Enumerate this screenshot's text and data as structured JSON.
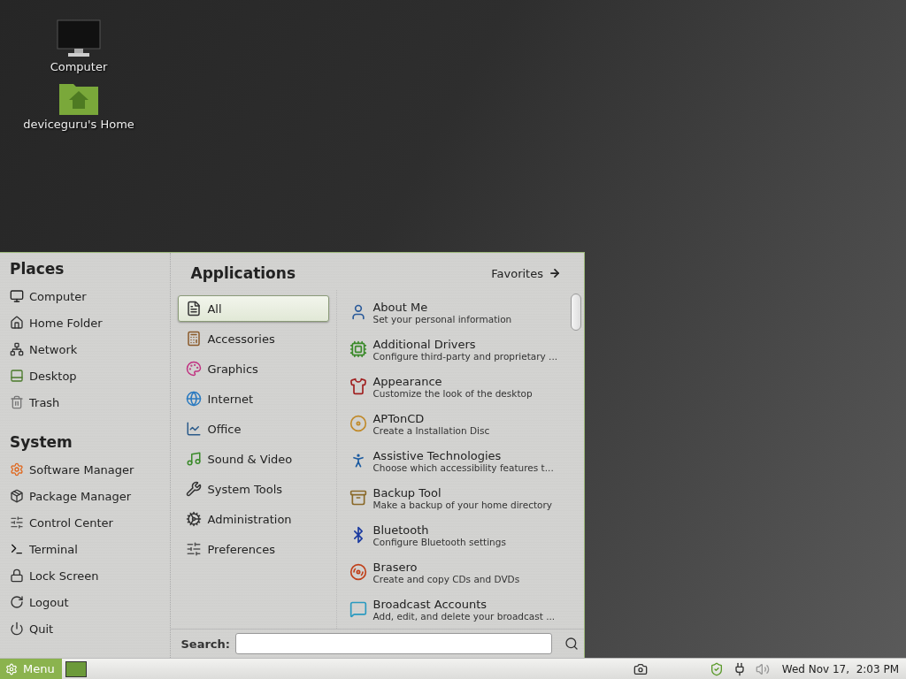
{
  "desktop_icons": [
    {
      "label": "Computer",
      "kind": "computer"
    },
    {
      "label": "deviceguru's Home",
      "kind": "home"
    }
  ],
  "menu": {
    "places": {
      "title": "Places",
      "items": [
        "Computer",
        "Home Folder",
        "Network",
        "Desktop",
        "Trash"
      ]
    },
    "system": {
      "title": "System",
      "items": [
        "Software Manager",
        "Package Manager",
        "Control Center",
        "Terminal",
        "Lock Screen",
        "Logout",
        "Quit"
      ]
    },
    "applications_title": "Applications",
    "favorites_button": "Favorites",
    "categories": [
      {
        "label": "All",
        "selected": true
      },
      {
        "label": "Accessories",
        "selected": false
      },
      {
        "label": "Graphics",
        "selected": false
      },
      {
        "label": "Internet",
        "selected": false
      },
      {
        "label": "Office",
        "selected": false
      },
      {
        "label": "Sound & Video",
        "selected": false
      },
      {
        "label": "System Tools",
        "selected": false
      },
      {
        "label": "Administration",
        "selected": false
      },
      {
        "label": "Preferences",
        "selected": false
      }
    ],
    "apps": [
      {
        "name": "About Me",
        "description": "Set your personal information"
      },
      {
        "name": "Additional Drivers",
        "description": "Configure third-party and proprietary ..."
      },
      {
        "name": "Appearance",
        "description": "Customize the look of the desktop"
      },
      {
        "name": "APTonCD",
        "description": "Create a Installation Disc"
      },
      {
        "name": "Assistive Technologies",
        "description": "Choose which accessibility features t..."
      },
      {
        "name": "Backup Tool",
        "description": "Make a backup of your home directory"
      },
      {
        "name": "Bluetooth",
        "description": "Configure Bluetooth settings"
      },
      {
        "name": "Brasero",
        "description": "Create and copy CDs and DVDs"
      },
      {
        "name": "Broadcast Accounts",
        "description": "Add, edit, and delete your broadcast ..."
      }
    ],
    "search": {
      "label": "Search:"
    }
  },
  "taskbar": {
    "menu_button": "Menu",
    "clock": "Wed Nov 17,  2:03 PM"
  }
}
